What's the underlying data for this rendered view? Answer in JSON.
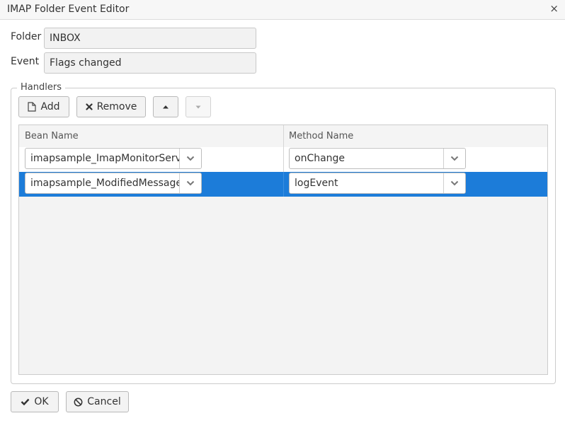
{
  "window": {
    "title": "IMAP Folder Event Editor"
  },
  "form": {
    "folder_label": "Folder",
    "folder_value": "INBOX",
    "event_label": "Event",
    "event_value": "Flags changed"
  },
  "handlers": {
    "legend": "Handlers",
    "add_label": "Add",
    "remove_label": "Remove",
    "columns": [
      "Bean Name",
      "Method Name"
    ],
    "rows": [
      {
        "bean": "imapsample_ImapMonitorServic",
        "method": "onChange",
        "selected": false
      },
      {
        "bean": "imapsample_ModifiedMessageS",
        "method": "logEvent",
        "selected": true
      }
    ]
  },
  "footer": {
    "ok_label": "OK",
    "cancel_label": "Cancel"
  },
  "colors": {
    "selection": "#1c7cd9",
    "border": "#cccccc",
    "field_bg": "#f2f2f2"
  },
  "icons": [
    "close-icon",
    "file-icon",
    "x-icon",
    "arrow-up-icon",
    "arrow-down-icon",
    "chevron-down-icon",
    "checkmark-icon",
    "ban-icon"
  ]
}
